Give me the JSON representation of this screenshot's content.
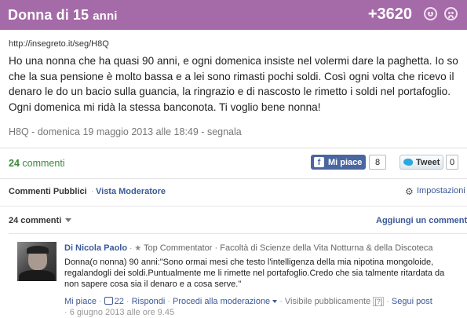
{
  "header": {
    "title": "Donna di 15",
    "title_age_suffix": "anni",
    "score": "+3620",
    "icons": [
      "smile-icon",
      "frown-icon"
    ]
  },
  "post": {
    "url": "http://insegreto.it/seg/H8Q",
    "body": "Ho una nonna che ha quasi 90 anni, e ogni domenica insiste nel volermi dare la paghetta. Io so che la sua pensione è molto bassa e a lei sono rimasti pochi soldi. Così ogni volta che ricevo il denaro le do un bacio sulla guancia, la ringrazio e di nascosto le rimetto i soldi nel portafoglio. Ogni domenica mi ridà la stessa banconota. Ti voglio bene nonna!",
    "meta_id": "H8Q",
    "meta_date": "domenica 19 maggio 2013 alle 18:49",
    "meta_report": "segnala"
  },
  "comments_bar": {
    "count": "24",
    "label": "commenti",
    "fb_label": "Mi piace",
    "fb_count": "8",
    "tw_label": "Tweet",
    "tw_count": "0"
  },
  "tabs": {
    "active": "Commenti Pubblici",
    "separator": "·",
    "other": "Vista Moderatore",
    "settings": "Impostazioni"
  },
  "sort": {
    "count_label": "24 commenti",
    "add_comment": "Aggiungi un commento"
  },
  "comment": {
    "author": "Di Nicola Paolo",
    "badge": "Top Commentator",
    "faculty": "Facoltà di Scienze della Vita Notturna & della Discoteca",
    "text": "Donna(o nonna) 90 anni:\"Sono ormai mesi che testo l'intelligenza della mia nipotina mongoloide, regalandogli dei soldi.Puntualmente me li rimette nel portafoglio.Credo che sia talmente ritardata da non sapere cosa sia il denaro e a cosa serve.\"",
    "like": "Mi piace",
    "like_count": "22",
    "reply": "Rispondi",
    "moderate": "Procedi alla moderazione",
    "visibility": "Visibile pubblicamente",
    "help": "[?]",
    "follow": "Segui post",
    "date": "6 giugno 2013 alle ore 9.45"
  },
  "colors": {
    "header_bg": "#a56aa8",
    "link": "#3b5998",
    "count_green": "#3a8a3a",
    "fb_blue": "#4a66a0"
  }
}
